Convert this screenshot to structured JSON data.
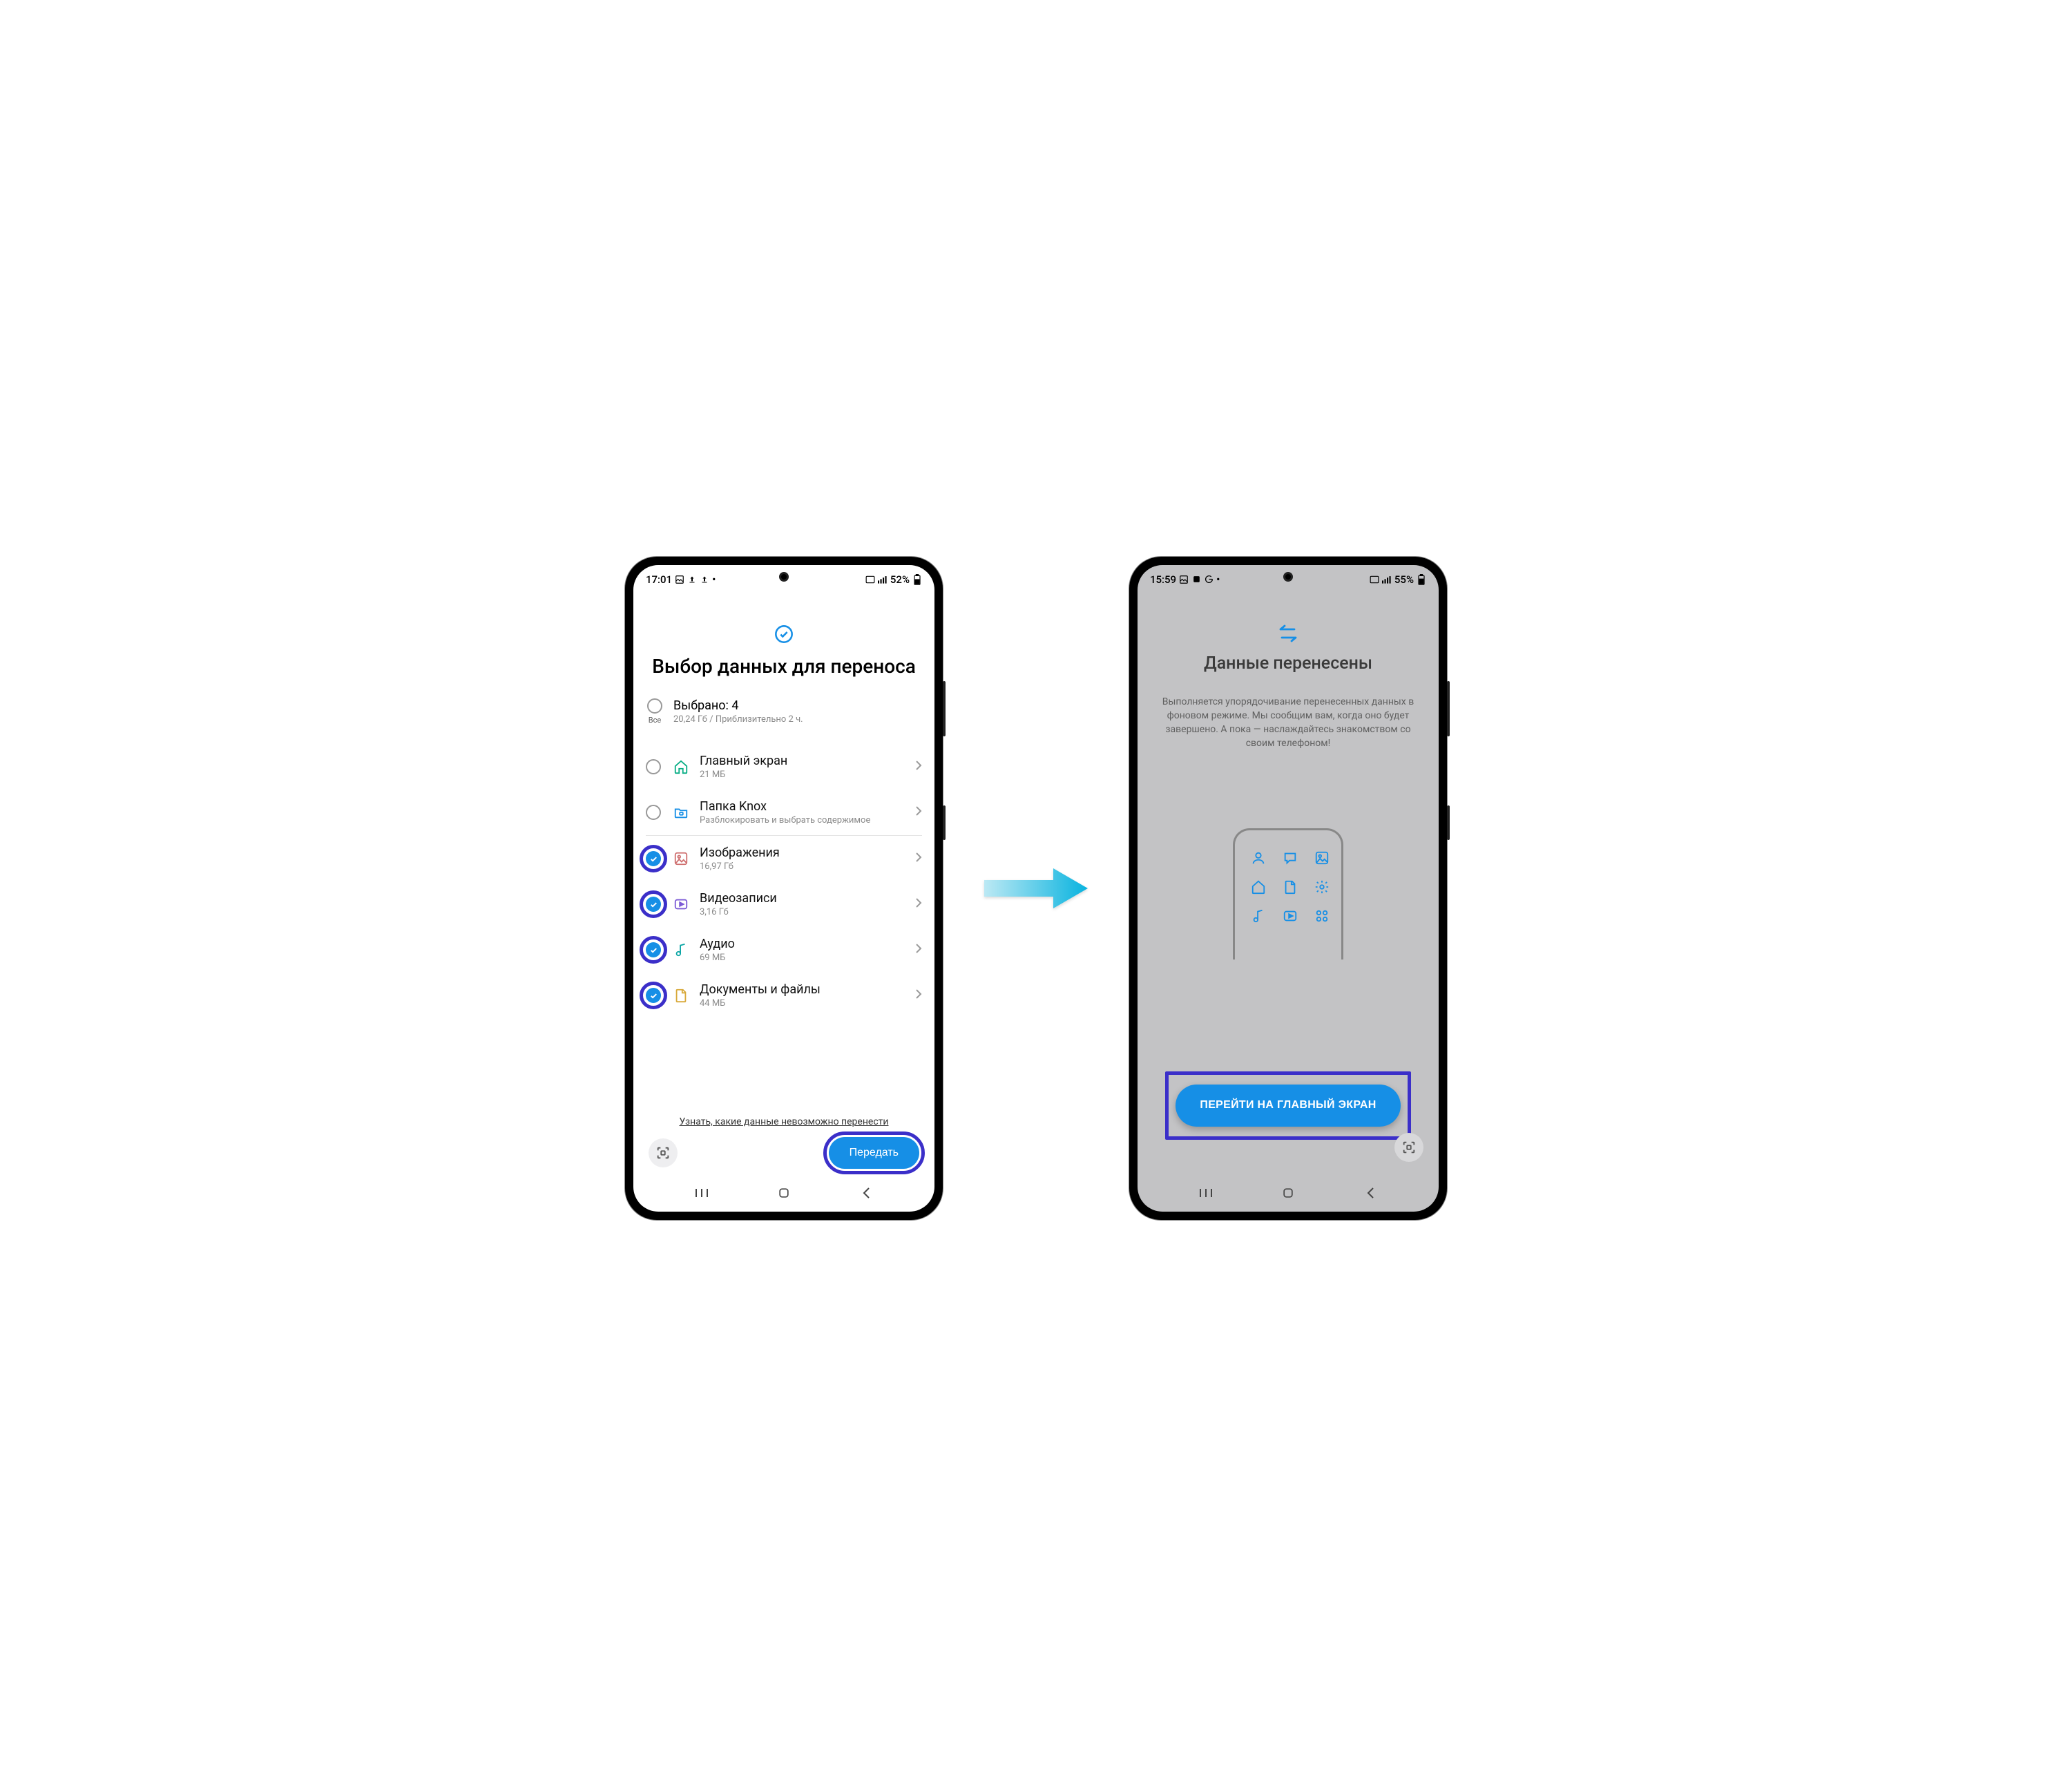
{
  "phone1": {
    "status": {
      "time": "17:01",
      "battery": "52%"
    },
    "title": "Выбор данных для переноса",
    "selectAll": {
      "label": "Все",
      "countLabel": "Выбрано: 4",
      "sub": "20,24 Гб / Приблизительно 2 ч."
    },
    "items": [
      {
        "title": "Главный экран",
        "sub": "21 МБ",
        "checked": false,
        "highlight": false,
        "iconColor": "#0aae86"
      },
      {
        "title": "Папка Knox",
        "sub": "Разблокировать и выбрать содержимое",
        "checked": false,
        "highlight": false,
        "iconColor": "#168fe6"
      },
      {
        "title": "Изображения",
        "sub": "16,97 Гб",
        "checked": true,
        "highlight": true,
        "iconColor": "#cf7070"
      },
      {
        "title": "Видеозаписи",
        "sub": "3,16 Гб",
        "checked": true,
        "highlight": true,
        "iconColor": "#7c5bd6"
      },
      {
        "title": "Аудио",
        "sub": "69 МБ",
        "checked": true,
        "highlight": true,
        "iconColor": "#0ba5a5"
      },
      {
        "title": "Документы и файлы",
        "sub": "44 МБ",
        "checked": true,
        "highlight": true,
        "iconColor": "#d8a93a"
      }
    ],
    "infoLink": "Узнать, какие данные невозможно перенести",
    "submit": "Передать"
  },
  "phone2": {
    "status": {
      "time": "15:59",
      "battery": "55%"
    },
    "title": "Данные перенесены",
    "desc": "Выполняется упорядочивание перенесенных данных в фоновом режиме. Мы сообщим вам, когда оно будет завершено. А пока — наслаждайтесь знакомством со своим телефоном!",
    "cta": "ПЕРЕЙТИ НА ГЛАВНЫЙ ЭКРАН"
  },
  "colors": {
    "accent": "#168fe6",
    "highlight": "#3b2fc9",
    "arrow": "#19b7e0"
  }
}
